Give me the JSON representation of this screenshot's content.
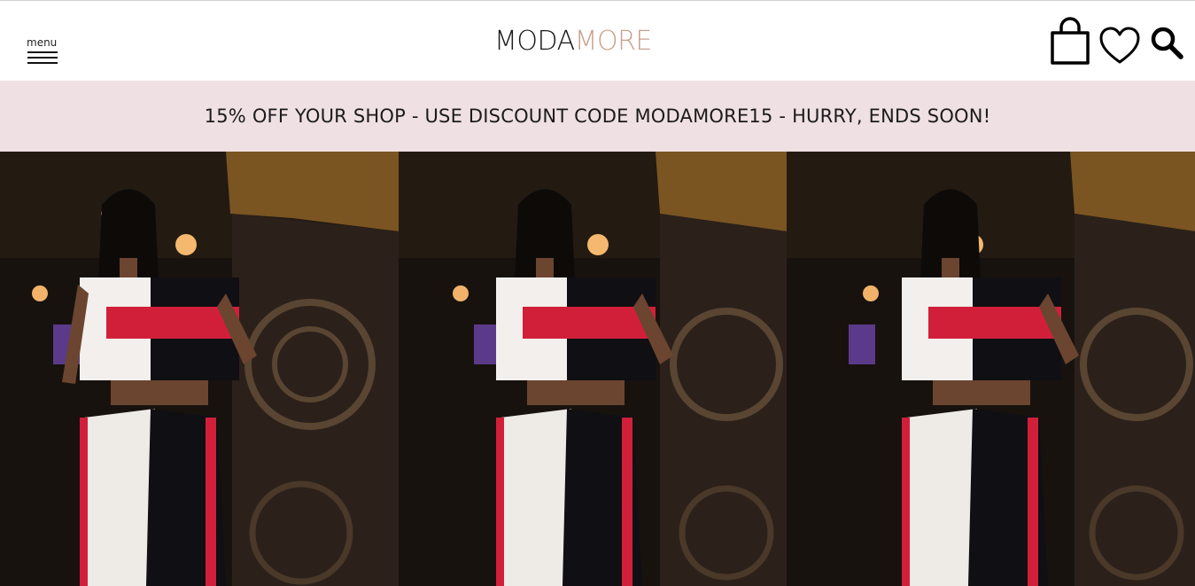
{
  "header": {
    "menu_label": "menu",
    "logo_part1": "MODA",
    "logo_part2": "MORE",
    "icons": [
      "shopping-bag-icon",
      "heart-icon",
      "search-icon"
    ]
  },
  "banner": {
    "text": "15% OFF YOUR SHOP - USE DISCOUNT CODE MODAMORE15 - HURRY, ENDS SOON!",
    "background": "#efe0e4"
  },
  "hero": {
    "image_count": 3
  },
  "colors": {
    "logo_dark": "#1a1a1a",
    "logo_accent": "#c9a08e",
    "outfit_red": "#d11f3a"
  }
}
